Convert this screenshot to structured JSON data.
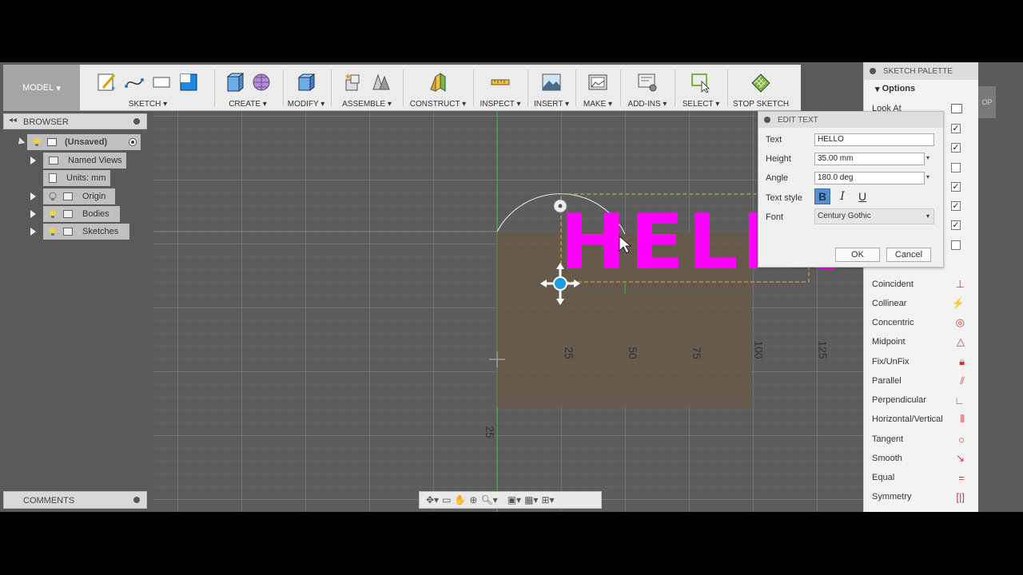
{
  "toolbar": {
    "model_label": "MODEL",
    "groups": [
      {
        "label": "SKETCH ▾"
      },
      {
        "label": "CREATE ▾"
      },
      {
        "label": "MODIFY ▾"
      },
      {
        "label": "ASSEMBLE ▾"
      },
      {
        "label": "CONSTRUCT ▾"
      },
      {
        "label": "INSPECT ▾"
      },
      {
        "label": "INSERT ▾"
      },
      {
        "label": "MAKE ▾"
      },
      {
        "label": "ADD-INS ▾"
      },
      {
        "label": "SELECT ▾"
      },
      {
        "label": "STOP SKETCH"
      }
    ]
  },
  "browser": {
    "title": "BROWSER",
    "root": "(Unsaved)",
    "items": [
      "Named Views",
      "Units: mm",
      "Origin",
      "Bodies",
      "Sketches"
    ]
  },
  "comments": {
    "title": "COMMENTS"
  },
  "sketch_text": "HELLO",
  "dimensions": [
    "25",
    "50",
    "75",
    "100",
    "125",
    "25",
    "75"
  ],
  "edit_text": {
    "title": "EDIT TEXT",
    "text_label": "Text",
    "text_value": "HELLO",
    "height_label": "Height",
    "height_value": "35.00 mm",
    "angle_label": "Angle",
    "angle_value": "180.0 deg",
    "style_label": "Text style",
    "bold": "B",
    "italic": "I",
    "underline": "U",
    "font_label": "Font",
    "font_value": "Century Gothic",
    "ok": "OK",
    "cancel": "Cancel"
  },
  "palette": {
    "title": "SKETCH PALETTE",
    "options": "Options",
    "look_at": "Look At",
    "checkboxes": [
      false,
      true,
      true,
      false,
      true,
      true,
      true,
      false
    ],
    "constraints": [
      {
        "label": "Coincident",
        "icon": "coincident-icon"
      },
      {
        "label": "Collinear",
        "icon": "collinear-icon"
      },
      {
        "label": "Concentric",
        "icon": "concentric-icon"
      },
      {
        "label": "Midpoint",
        "icon": "midpoint-icon"
      },
      {
        "label": "Fix/UnFix",
        "icon": "lock-icon"
      },
      {
        "label": "Parallel",
        "icon": "parallel-icon"
      },
      {
        "label": "Perpendicular",
        "icon": "perpendicular-icon"
      },
      {
        "label": "Horizontal/Vertical",
        "icon": "horizontal-vertical-icon"
      },
      {
        "label": "Tangent",
        "icon": "tangent-icon"
      },
      {
        "label": "Smooth",
        "icon": "smooth-icon"
      },
      {
        "label": "Equal",
        "icon": "equal-icon"
      },
      {
        "label": "Symmetry",
        "icon": "symmetry-icon"
      }
    ]
  },
  "side_tab": "OP",
  "colors": {
    "accent": "#ff00ff",
    "blue": "#1e9be0",
    "panel": "#f3f3f3"
  }
}
